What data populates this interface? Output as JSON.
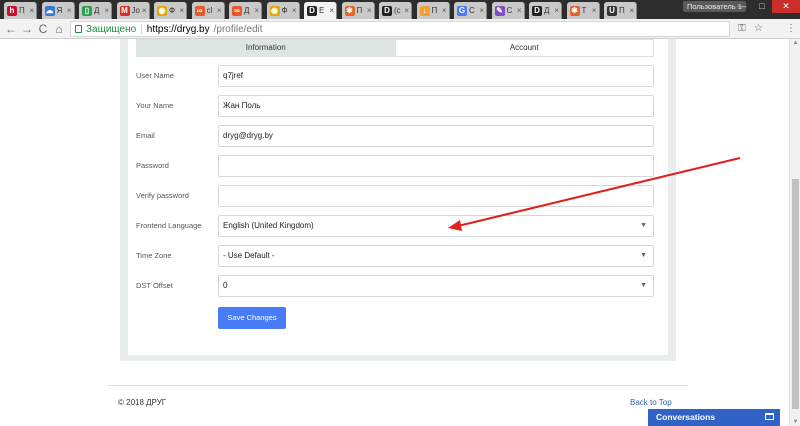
{
  "browser": {
    "tabs": [
      {
        "title": "П",
        "icon": "h-icon",
        "color": "#c8102e",
        "glyph": "h"
      },
      {
        "title": "Я",
        "icon": "cloud-icon",
        "color": "#3a78d6",
        "glyph": "☁"
      },
      {
        "title": "Д",
        "icon": "doc-icon",
        "color": "#2e9e4e",
        "glyph": "▯"
      },
      {
        "title": "Jo",
        "icon": "gmail-icon",
        "color": "#d93025",
        "glyph": "M"
      },
      {
        "title": "Ф",
        "icon": "chrome-icon",
        "color": "#e0a800",
        "glyph": "◉"
      },
      {
        "title": "сl",
        "icon": "link-icon",
        "color": "#e55a2b",
        "glyph": "∞"
      },
      {
        "title": "Д",
        "icon": "link-icon",
        "color": "#e55a2b",
        "glyph": "∞"
      },
      {
        "title": "Ф",
        "icon": "chrome-icon",
        "color": "#e0a800",
        "glyph": "◉"
      },
      {
        "title": "Е",
        "icon": "d-icon",
        "color": "#222222",
        "glyph": "D"
      },
      {
        "title": "П",
        "icon": "joomla-icon",
        "color": "#e0662a",
        "glyph": "✱"
      },
      {
        "title": "(с",
        "icon": "d-icon",
        "color": "#222222",
        "glyph": "D"
      },
      {
        "title": "П",
        "icon": "download-icon",
        "color": "#f0a030",
        "glyph": "↓"
      },
      {
        "title": "С",
        "icon": "translate-icon",
        "color": "#4a7bf7",
        "glyph": "G"
      },
      {
        "title": "С",
        "icon": "pen-icon",
        "color": "#7a4fc0",
        "glyph": "✎"
      },
      {
        "title": "Д",
        "icon": "d-icon",
        "color": "#222222",
        "glyph": "D"
      },
      {
        "title": "Т",
        "icon": "joomla-icon",
        "color": "#e0662a",
        "glyph": "✱"
      },
      {
        "title": "П",
        "icon": "u-icon",
        "color": "#333333",
        "glyph": "U"
      }
    ],
    "close_glyph": "×",
    "profile_label": "Пользователь 1",
    "window_controls": {
      "minimize": "—",
      "maximize": "□",
      "close": "✕"
    },
    "nav": {
      "back": "←",
      "forward": "→",
      "reload": "C",
      "home": "⌂"
    },
    "secure_label": "Защищено",
    "url_host": "https://dryg.by",
    "url_path": "/profile/edit",
    "toolbar_icons": {
      "key": "⚿",
      "star": "☆",
      "menu": "⋮"
    }
  },
  "form": {
    "tabs": {
      "info": "Information",
      "account": "Account"
    },
    "fields": [
      {
        "label": "User Name",
        "value": "q7jref",
        "type": "text"
      },
      {
        "label": "Your Name",
        "value": "Жан Поль",
        "type": "text"
      },
      {
        "label": "Email",
        "value": "dryg@dryg.by",
        "type": "text"
      },
      {
        "label": "Password",
        "value": "",
        "type": "password"
      },
      {
        "label": "Verify password",
        "value": "",
        "type": "password"
      },
      {
        "label": "Frontend Language",
        "value": "English (United Kingdom)",
        "type": "select"
      },
      {
        "label": "Time Zone",
        "value": "- Use Default -",
        "type": "select"
      },
      {
        "label": "DST Offset",
        "value": "0",
        "type": "select"
      }
    ],
    "caret": "▼",
    "save_label": "Save Changes"
  },
  "footer": {
    "copyright": "© 2018 ДРУГ",
    "back_to_top": "Back to Top"
  },
  "chat": {
    "label": "Conversations"
  },
  "colors": {
    "accent": "#4a7bf7",
    "annotation_arrow": "#e0201c",
    "chat_bar": "#3163c7"
  }
}
